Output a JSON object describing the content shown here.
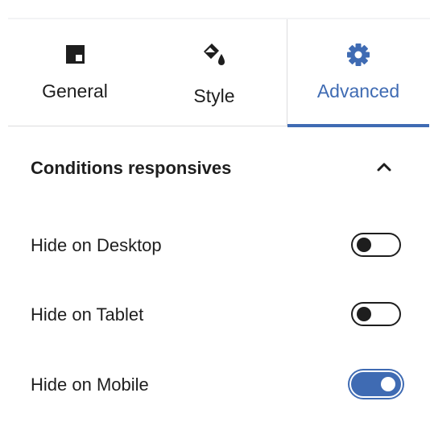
{
  "colors": {
    "accent": "#3f6bb3",
    "text": "#1e1e1e",
    "divider": "#dcdcde"
  },
  "tabs": [
    {
      "label": "General",
      "icon": "layout-block-icon",
      "active": false
    },
    {
      "label": "Style",
      "icon": "paint-bucket-icon",
      "active": false
    },
    {
      "label": "Advanced",
      "icon": "gear-icon",
      "active": true
    }
  ],
  "section": {
    "title": "Conditions responsives",
    "expanded": true,
    "toggle_icon": "chevron-up-icon"
  },
  "rows": [
    {
      "label": "Hide on Desktop",
      "enabled": false
    },
    {
      "label": "Hide on Tablet",
      "enabled": false
    },
    {
      "label": "Hide on Mobile",
      "enabled": true
    }
  ]
}
